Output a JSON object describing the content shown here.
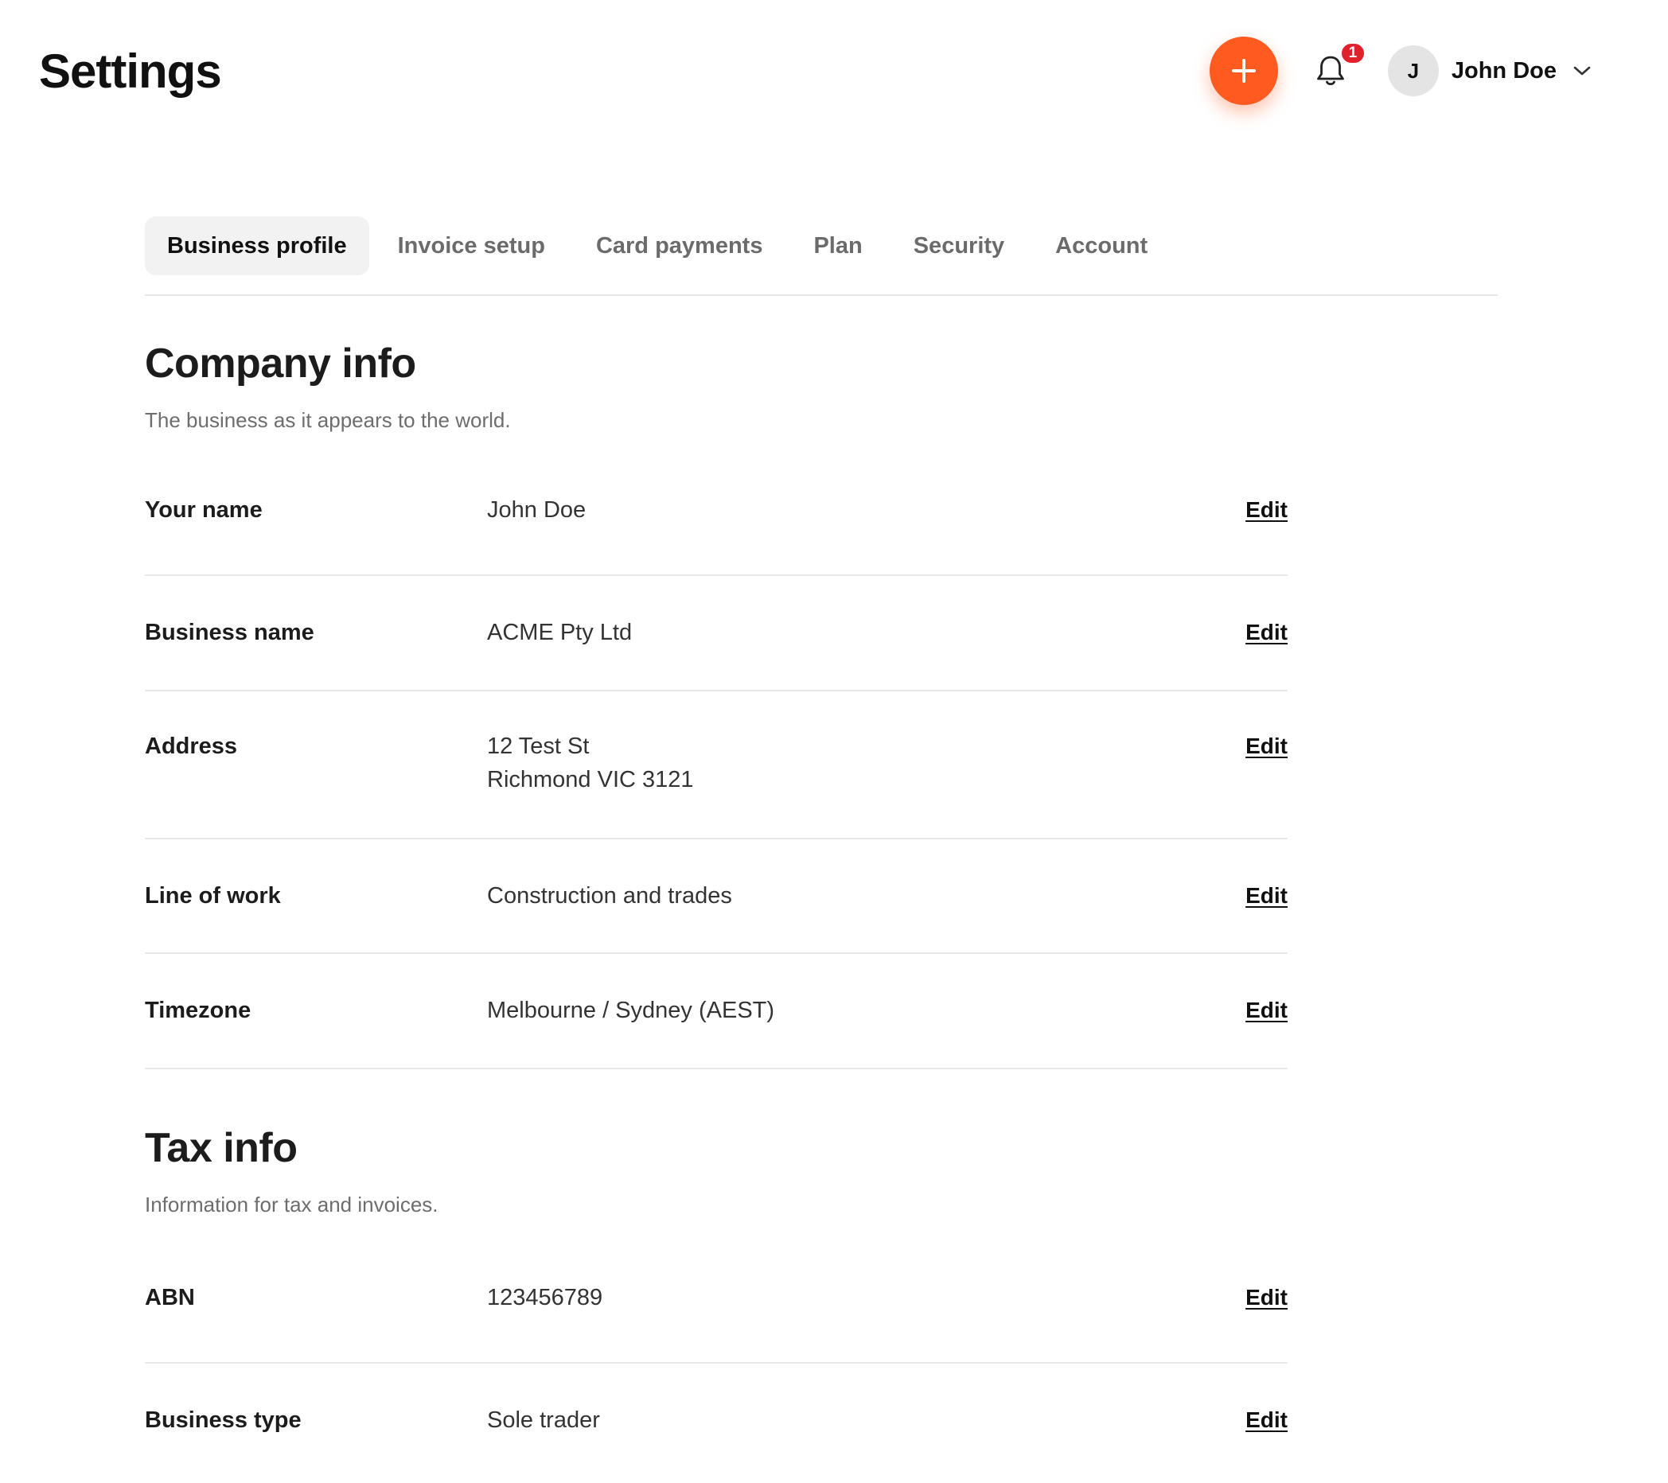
{
  "header": {
    "title": "Settings",
    "add_icon": "plus-icon",
    "bell_icon": "bell-icon",
    "notification_count": "1",
    "user": {
      "initial": "J",
      "name": "John Doe",
      "menu_icon": "chevron-down-icon"
    }
  },
  "tabs": [
    {
      "label": "Business profile",
      "active": true
    },
    {
      "label": "Invoice setup",
      "active": false
    },
    {
      "label": "Card payments",
      "active": false
    },
    {
      "label": "Plan",
      "active": false
    },
    {
      "label": "Security",
      "active": false
    },
    {
      "label": "Account",
      "active": false
    }
  ],
  "company_info": {
    "title": "Company info",
    "subtitle": "The business as it appears to the world.",
    "rows": [
      {
        "label": "Your name",
        "value_lines": [
          "John Doe"
        ],
        "action": "Edit"
      },
      {
        "label": "Business name",
        "value_lines": [
          "ACME Pty Ltd"
        ],
        "action": "Edit"
      },
      {
        "label": "Address",
        "value_lines": [
          "12 Test St",
          "Richmond VIC 3121"
        ],
        "action": "Edit"
      },
      {
        "label": "Line of work",
        "value_lines": [
          "Construction and trades"
        ],
        "action": "Edit"
      },
      {
        "label": "Timezone",
        "value_lines": [
          "Melbourne / Sydney (AEST)"
        ],
        "action": "Edit"
      }
    ]
  },
  "tax_info": {
    "title": "Tax info",
    "subtitle": "Information for tax and invoices.",
    "rows": [
      {
        "label": "ABN",
        "value_lines": [
          "123456789"
        ],
        "action": "Edit"
      },
      {
        "label": "Business type",
        "value_lines": [
          "Sole trader"
        ],
        "action": "Edit"
      }
    ]
  },
  "colors": {
    "accent": "#ff5a1f",
    "badge": "#e0202a",
    "active_tab_bg": "#f2f2f2",
    "divider": "#e8e8e8"
  }
}
